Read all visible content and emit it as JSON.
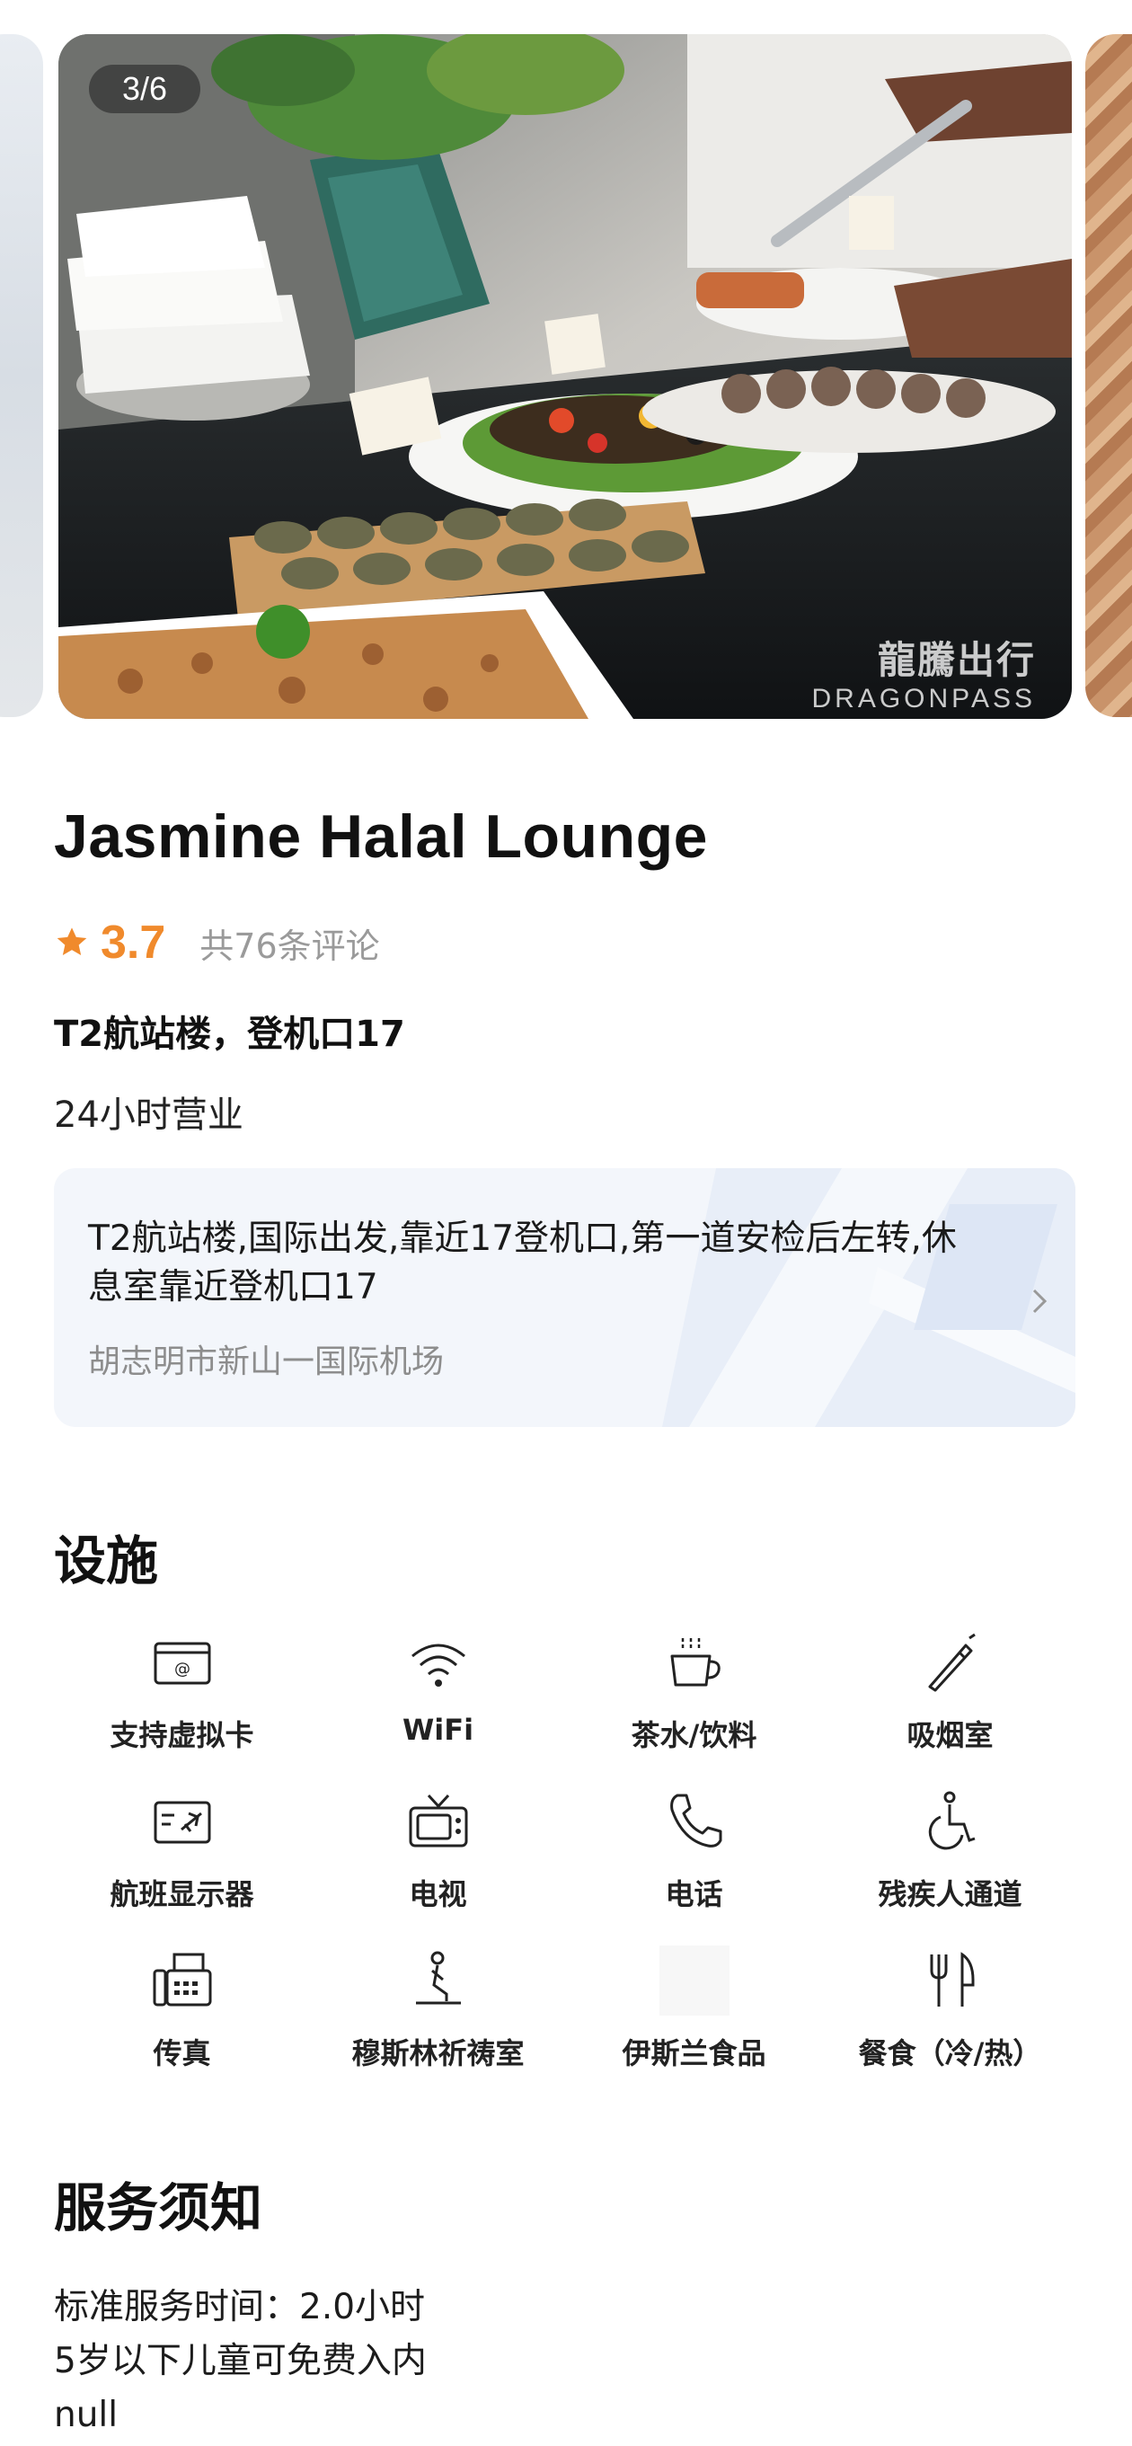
{
  "gallery": {
    "counter": "3/6",
    "watermark_cn": "龍騰出行",
    "watermark_en": "DRAGONPASS"
  },
  "lounge": {
    "name": "Jasmine Halal Lounge",
    "rating": "3.7",
    "reviews": "共76条评论",
    "terminal": "T2航站楼，登机口17",
    "hours": "24小时营业"
  },
  "location": {
    "directions": "T2航站楼,国际出发,靠近17登机口,第一道安检后左转,休息室靠近登机口17",
    "airport": "胡志明市新山一国际机场"
  },
  "facilities": {
    "heading": "设施",
    "items": [
      {
        "label": "支持虚拟卡",
        "icon": "virtual-card-icon"
      },
      {
        "label": "WiFi",
        "icon": "wifi-icon"
      },
      {
        "label": "茶水/饮料",
        "icon": "coffee-cup-icon"
      },
      {
        "label": "吸烟室",
        "icon": "cigarette-icon"
      },
      {
        "label": "航班显示器",
        "icon": "flight-display-icon"
      },
      {
        "label": "电视",
        "icon": "tv-icon"
      },
      {
        "label": "电话",
        "icon": "phone-icon"
      },
      {
        "label": "残疾人通道",
        "icon": "wheelchair-icon"
      },
      {
        "label": "传真",
        "icon": "fax-icon"
      },
      {
        "label": "穆斯林祈祷室",
        "icon": "prayer-icon"
      },
      {
        "label": "伊斯兰食品",
        "icon": "blank-icon"
      },
      {
        "label": "餐食（冷/热）",
        "icon": "fork-knife-icon"
      }
    ]
  },
  "service": {
    "heading": "服务须知",
    "lines": [
      "标准服务时间：2.0小时",
      "5岁以下儿童可免费入内",
      "null"
    ]
  },
  "colors": {
    "accent": "#f08a2c",
    "card_bg": "#f3f6fb",
    "muted": "#9a9a9a"
  }
}
